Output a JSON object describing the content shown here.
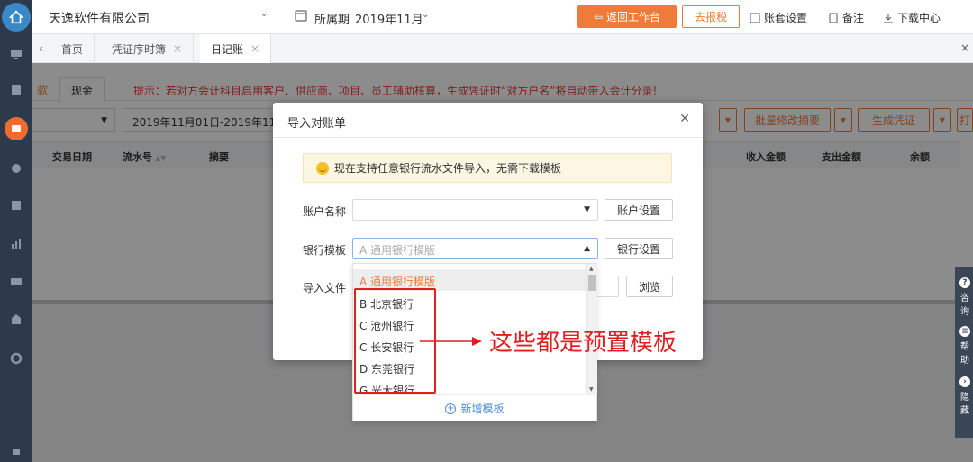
{
  "topbar": {
    "company": "天逸软件有限公司",
    "period_label": "所属期",
    "period_value": "2019年11月",
    "return_btn": "返回工作台",
    "tax_btn": "去报税",
    "links": [
      "账套设置",
      "备注",
      "下载中心"
    ]
  },
  "tabs": [
    {
      "label": "首页",
      "closable": false
    },
    {
      "label": "凭证序时簿",
      "closable": true
    },
    {
      "label": "日记账",
      "closable": true
    }
  ],
  "subtabs": {
    "first": "款",
    "second": "现金"
  },
  "notice": "提示：若对方会计科目启用客户、供应商、项目、员工辅助核算，生成凭证时“对方户名”将自动带入会计分录!",
  "filter": {
    "date_range": "2019年11月01日-2019年11月",
    "batch_btn": "批量修改摘要",
    "gen_btn": "生成凭证",
    "print_btn": "打"
  },
  "table": {
    "headers": [
      "交易日期",
      "流水号",
      "摘要",
      "收入金额",
      "支出金额",
      "余额"
    ]
  },
  "float_panel": [
    "咨询",
    "帮助",
    "隐藏"
  ],
  "modal": {
    "title": "导入对账单",
    "tip": "现在支持任意银行流水文件导入，无需下载模板",
    "account_label": "账户名称",
    "account_btn": "账户设置",
    "bank_label": "银行模板",
    "bank_placeholder": "A 通用银行模版",
    "bank_btn": "银行设置",
    "file_label": "导入文件",
    "browse_btn": "浏览"
  },
  "dropdown": {
    "items": [
      "A 通用银行模版",
      "B 北京银行",
      "C 沧州银行",
      "C 长安银行",
      "D 东莞银行",
      "G 光大银行"
    ],
    "selected_index": 0,
    "footer": "新增模板"
  },
  "annotation": "这些都是预置模板",
  "colors": {
    "accent": "#f07a3a",
    "rail": "#2d3a4b",
    "annotation": "#e02020",
    "link": "#4a8fd6"
  }
}
